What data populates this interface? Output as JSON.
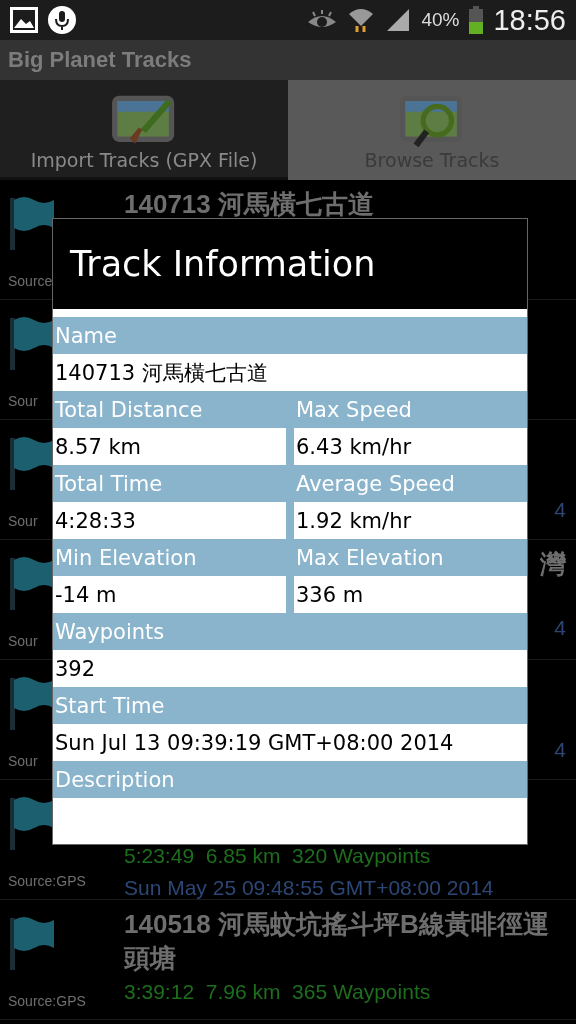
{
  "status_bar": {
    "battery": "40%",
    "time": "18:56"
  },
  "app_bar": {
    "title": "Big Planet Tracks"
  },
  "tabs": [
    {
      "label": "Import Tracks (GPX File)",
      "selected": false,
      "kind": "import"
    },
    {
      "label": "Browse Tracks",
      "selected": true,
      "kind": "browse"
    }
  ],
  "tracks": [
    {
      "kind": "full",
      "title": "140713 河馬橫七古道",
      "source": "Source"
    },
    {
      "kind": "edge",
      "source": "Sour"
    },
    {
      "kind": "edge",
      "source": "Sour",
      "date": "4"
    },
    {
      "kind": "edge",
      "source": "Sour",
      "title": "灣",
      "date": "4"
    },
    {
      "kind": "edge",
      "source": "Sour",
      "date": "4"
    },
    {
      "kind": "full",
      "source": "Source:GPS",
      "stats": "5:23:49  6.85 km  320 Waypoints",
      "date": "Sun May 25 09:48:55 GMT+08:00 2014"
    },
    {
      "kind": "full",
      "title": "140518 河馬蚊坑搖斗坪B線黃啡徑運頭塘",
      "source": "Source:GPS",
      "stats": "3:39:12  7.96 km  365 Waypoints"
    }
  ],
  "dialog": {
    "title": "Track Information",
    "fields": [
      [
        {
          "label": "Name",
          "value": "140713 河馬橫七古道"
        }
      ],
      [
        {
          "label": "Total Distance",
          "value": "8.57 km"
        },
        {
          "label": "Max Speed",
          "value": "6.43 km/hr"
        }
      ],
      [
        {
          "label": "Total Time",
          "value": "4:28:33"
        },
        {
          "label": "Average Speed",
          "value": "1.92 km/hr"
        }
      ],
      [
        {
          "label": "Min Elevation",
          "value": "-14 m"
        },
        {
          "label": "Max Elevation",
          "value": "336 m"
        }
      ],
      [
        {
          "label": "Waypoints",
          "value": "392"
        }
      ],
      [
        {
          "label": "Start Time",
          "value": "Sun Jul 13 09:39:19 GMT+08:00 2014"
        }
      ],
      [
        {
          "label": "Description"
        }
      ]
    ]
  }
}
